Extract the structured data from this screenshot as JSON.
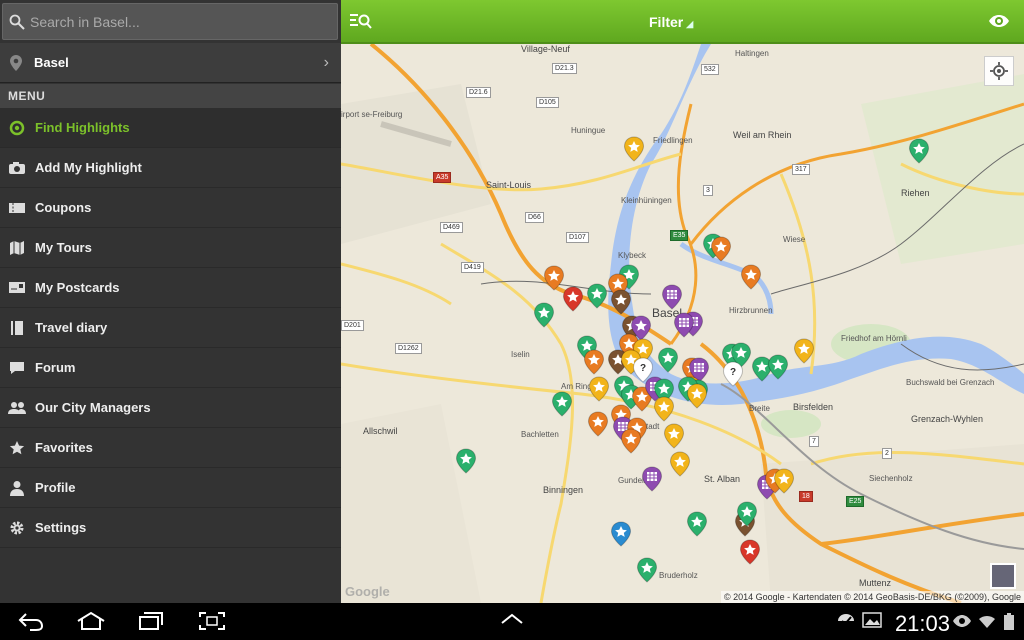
{
  "search": {
    "placeholder": "Search in Basel..."
  },
  "location": {
    "label": "Basel"
  },
  "menu": {
    "header": "MENU",
    "items": [
      {
        "label": "Find Highlights",
        "icon": "target-icon",
        "active": true
      },
      {
        "label": "Add My Highlight",
        "icon": "camera-icon"
      },
      {
        "label": "Coupons",
        "icon": "ticket-icon"
      },
      {
        "label": "My Tours",
        "icon": "map-icon"
      },
      {
        "label": "My Postcards",
        "icon": "postcard-icon"
      },
      {
        "label": "Travel diary",
        "icon": "book-icon"
      },
      {
        "label": "Forum",
        "icon": "chat-icon"
      },
      {
        "label": "Our City Managers",
        "icon": "people-icon"
      },
      {
        "label": "Favorites",
        "icon": "star-icon"
      },
      {
        "label": "Profile",
        "icon": "person-icon"
      },
      {
        "label": "Settings",
        "icon": "gear-icon"
      }
    ]
  },
  "topbar": {
    "filter_label": "Filter"
  },
  "map": {
    "labels": {
      "village_neuf": "Village-Neuf",
      "saint_louis": "Saint-Louis",
      "huningue": "Huningue",
      "friedlingen": "Friedlingen",
      "haltingen": "Haltingen",
      "weil": "Weil am Rhein",
      "kleinhuningen": "Kleinhüningen",
      "klybeck": "Klybeck",
      "basel": "Basel",
      "hirzbrunnen": "Hirzbrunnen",
      "iselin": "Iselin",
      "am_ring": "Am Ring",
      "bachletten": "Bachletten",
      "allschwil": "Allschwil",
      "binningen": "Binningen",
      "gundeli": "Gundeli",
      "st_alban": "St. Alban",
      "breite": "Breite",
      "birsfelden": "Birsfelden",
      "riehen": "Riehen",
      "friedhof": "Friedhof am Hörnli",
      "buchswald": "Buchswald bei Grenzach",
      "grenzach": "Grenzach-Wyhlen",
      "siechenholz": "Siechenholz",
      "bruderholz": "Bruderholz",
      "muttenz": "Muttenz",
      "wiese": "Wiese",
      "airport": "irport\nse-Freiburg",
      "altstadt": "tadt"
    },
    "shields": [
      "D21.3",
      "D21.6",
      "D105",
      "A35",
      "D66",
      "D107",
      "D469",
      "D419",
      "D201",
      "D1262",
      "532",
      "317",
      "3",
      "E35",
      "7",
      "2",
      "18",
      "E25"
    ],
    "copyright": "© 2014 Google - Kartendaten © 2014 GeoBasis-DE/BKG (©2009), Google"
  },
  "statusbar": {
    "time": "21:03"
  },
  "colors": {
    "accent": "#7cc12a",
    "topbar": "#6cb825",
    "river": "#a8c4f0"
  }
}
